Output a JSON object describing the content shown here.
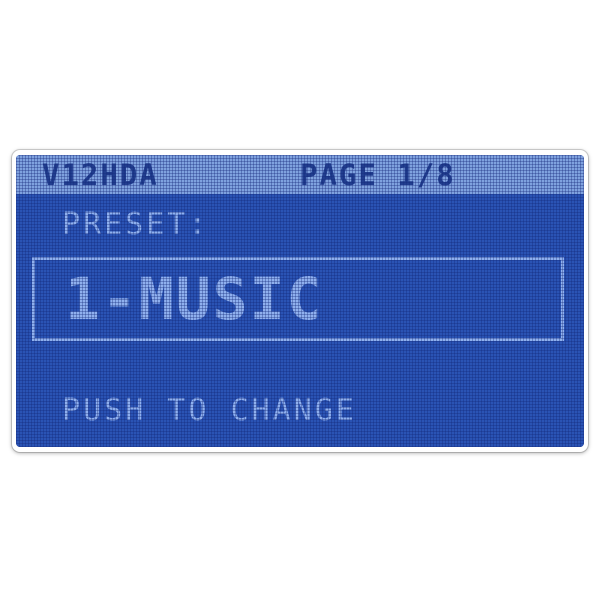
{
  "header": {
    "device_name": "V12HDA",
    "page_indicator": "PAGE 1/8"
  },
  "preset": {
    "label": "PRESET:",
    "value": "1-MUSIC"
  },
  "hint": "PUSH TO CHANGE",
  "colors": {
    "screen_background": "#2a53b4",
    "header_background": "#7fa2df",
    "header_text": "#213d8f",
    "text": "#8fb0ee"
  }
}
